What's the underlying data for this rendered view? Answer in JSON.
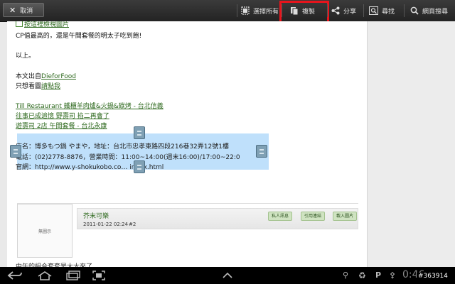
{
  "actionbar": {
    "cancel_label": "取消",
    "select_all_label": "選擇所有",
    "copy_label": "複製",
    "share_label": "分享",
    "find_label": "尋找",
    "web_search_label": "網頁搜尋"
  },
  "content": {
    "line_photo": "按這裡檢視圖片",
    "line_cp": "CP值最高的，還是午間套餐的明太子吃到飽!",
    "line_end": "以上。",
    "from_prefix": "本文出自",
    "from_link": "DieforFood",
    "pics_prefix": "只想看圖",
    "pics_link": "請點我",
    "related1": "Till Restaurant 鐵櫃羊肉爐&火鍋&碳烤 - 台北信義",
    "related2": "往事已成追憶 野壽司 掐二再會了",
    "related3": "遊壽司 2店 午間套餐 - 台北永康",
    "sel_line1": "店名：博多もつ鍋 やまや，地址：台北市忠孝東路四段216巷32弄12號1樓",
    "sel_line2": "電話：(02)2778-8876，營業時間：11:00~14:00(週末16:00)/17:00~22:0",
    "sel_line3": "官網：http://www.y-shokukobo.co… index.html",
    "bottom_partial": "中午的組合套套是太太來了 ..."
  },
  "post": {
    "avatar_text": "無圖示",
    "author": "芥末可樂",
    "date": "2011-01-22 02:24",
    "number": "#2",
    "btn_pm": "私人訊息",
    "btn_link": "引用連結",
    "btn_img": "載入圖片"
  },
  "system": {
    "watermark": "#363914",
    "time": "0:46"
  },
  "colors": {
    "highlight": "#e8141c",
    "selection": "#bfe0fb",
    "link_green": "#2f6a1f"
  }
}
